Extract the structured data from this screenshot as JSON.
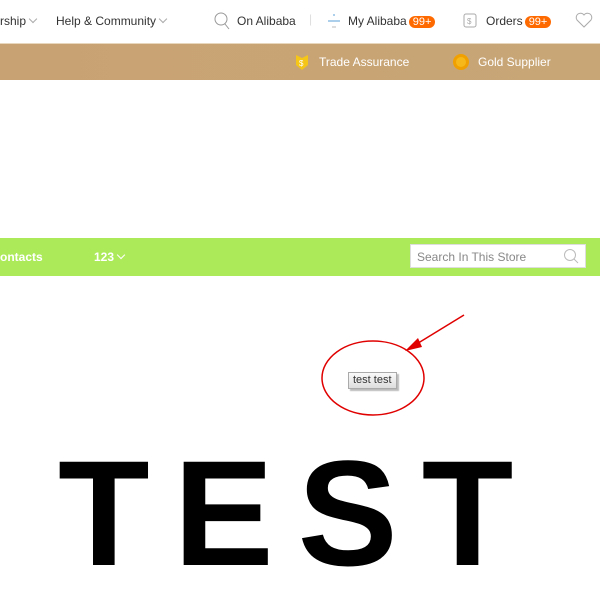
{
  "topnav": {
    "items": [
      {
        "label": "rship"
      },
      {
        "label": "Help & Community"
      }
    ],
    "on_alibaba": "On Alibaba",
    "my_alibaba": "My Alibaba",
    "my_alibaba_badge": "99+",
    "orders": "Orders",
    "orders_badge": "99+"
  },
  "banner": {
    "trade_assurance": "Trade Assurance",
    "gold_supplier": "Gold Supplier"
  },
  "store_nav": {
    "contacts": "ontacts",
    "menu_123": "123",
    "search_placeholder": "Search In This Store"
  },
  "content": {
    "button_label": "test test",
    "big_text": "TEST"
  },
  "colors": {
    "accent_green": "#adea5a",
    "badge_orange": "#ff6a00",
    "banner_tan": "#c9a273",
    "annotation_red": "#e00000"
  }
}
